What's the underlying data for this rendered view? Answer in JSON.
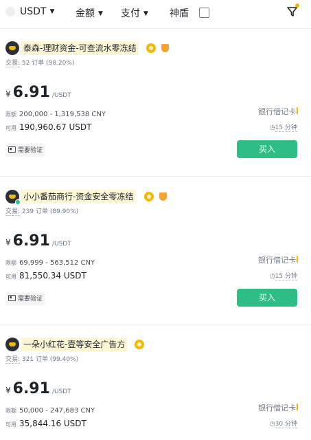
{
  "filters": {
    "coin": "USDT",
    "amount": "金额",
    "payment": "支付",
    "shield": "神盾"
  },
  "ads": [
    {
      "merchant": "泰森-理财资金-可查流水零冻结",
      "trades_label": "交易:",
      "trades_value": "52 订单 (98.20%)",
      "currency_symbol": "¥",
      "price": "6.91",
      "price_unit": "/USDT",
      "limit_label": "限额",
      "limit": "200,000 - 1,319,538 CNY",
      "available_label": "可用",
      "available": "190,960.67 USDT",
      "payment_method": "银行借记卡",
      "time_limit": "15 分钟",
      "verification": "需要验证",
      "action": "买入",
      "online": false
    },
    {
      "merchant": "小小番茄商行-资金安全零冻结",
      "trades_label": "交易:",
      "trades_value": "239 订单 (89.90%)",
      "currency_symbol": "¥",
      "price": "6.91",
      "price_unit": "/USDT",
      "limit_label": "限额",
      "limit": "69,999 - 563,512 CNY",
      "available_label": "可用",
      "available": "81,550.34 USDT",
      "payment_method": "银行借记卡",
      "time_limit": "15 分钟",
      "verification": "需要验证",
      "action": "买入",
      "online": true
    },
    {
      "merchant": "一朵小红花-壹等安全广告方",
      "trades_label": "交易:",
      "trades_value": "321 订单 (99.40%)",
      "currency_symbol": "¥",
      "price": "6.91",
      "price_unit": "/USDT",
      "limit_label": "限额",
      "limit": "50,000 - 247,683 CNY",
      "available_label": "可用",
      "available": "35,844.16 USDT",
      "payment_method": "银行借记卡",
      "time_limit": "30 分钟",
      "online": false
    }
  ],
  "colors": {
    "buy_green": "#2ebd85",
    "brand_yellow": "#f0b90b",
    "merchant_highlight": "#fdf6d4"
  }
}
